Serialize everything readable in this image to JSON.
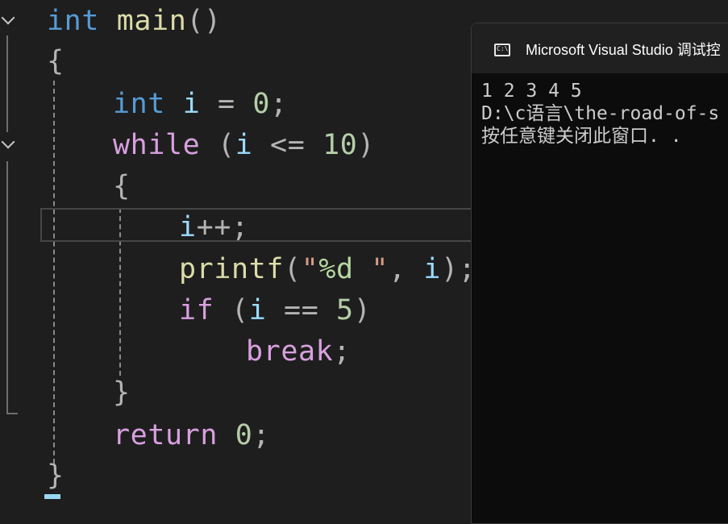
{
  "editor": {
    "code": {
      "l1": {
        "t1": "int",
        "t2": "main",
        "t3": "()"
      },
      "l2": {
        "t1": "{"
      },
      "l3": {
        "t1": "int",
        "t2": "i",
        "t3": "=",
        "t4": "0",
        "t5": ";"
      },
      "l4": {
        "t1": "while",
        "t2": "(",
        "t3": "i",
        "t4": "<=",
        "t5": "10",
        "t6": ")"
      },
      "l5": {
        "t1": "{"
      },
      "l6": {
        "t1": "i",
        "t2": "++;"
      },
      "l7": {
        "t1": "printf",
        "t2": "(",
        "t3": "\"",
        "t4": "%d",
        "t5": " \"",
        "t6": ",",
        "t7": "i",
        "t8": ");"
      },
      "l8": {
        "t1": "if",
        "t2": "(",
        "t3": "i",
        "t4": "==",
        "t5": "5",
        "t6": ")"
      },
      "l9": {
        "t1": "break",
        "t2": ";"
      },
      "l10": {
        "t1": "}"
      },
      "l11": {
        "t1": "return",
        "t2": "0",
        "t3": ";"
      },
      "l12": {
        "t1": "}"
      }
    }
  },
  "console": {
    "title": "Microsoft Visual Studio 调试控",
    "icon": "cmd-icon",
    "icon_text": "C:\\",
    "output": [
      "1 2 3 4 5",
      "D:\\c语言\\the-road-of-s",
      "按任意键关闭此窗口. ."
    ]
  }
}
